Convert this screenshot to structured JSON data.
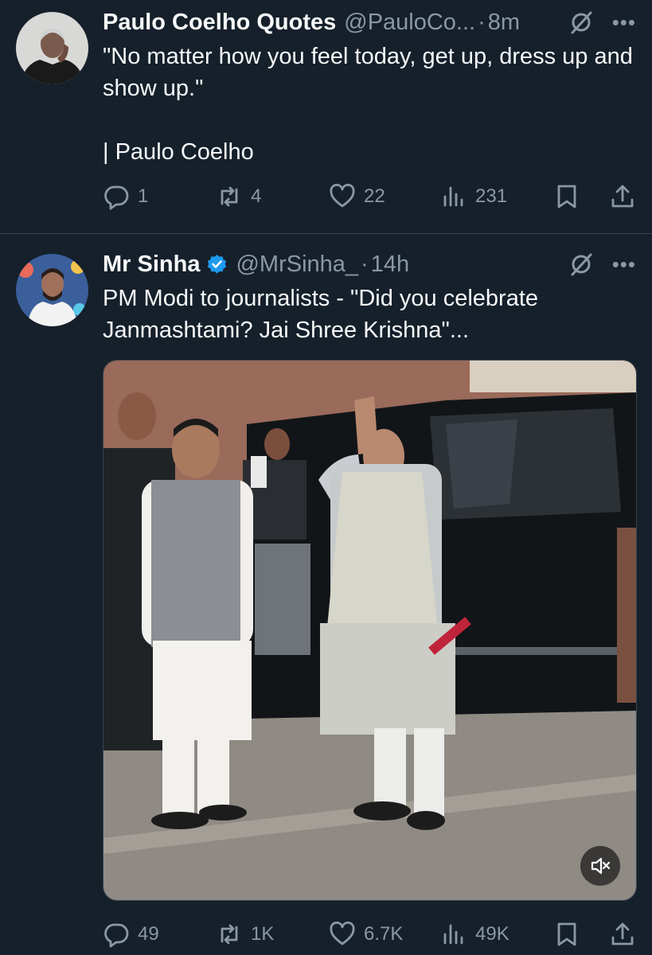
{
  "colors": {
    "background": "#15202b",
    "text": "#f7f9f9",
    "muted": "#8b98a5",
    "divider": "#38444d",
    "verified": "#1d9bf0"
  },
  "tweets": [
    {
      "display_name": "Paulo Coelho Quotes",
      "handle": "@PauloCo...",
      "separator": "·",
      "time": "8m",
      "verified": false,
      "text_lines": [
        "\"No matter how you feel today, get up, dress up and show up.\"",
        "| Paulo Coelho"
      ],
      "replies": "1",
      "retweets": "4",
      "likes": "22",
      "views": "231",
      "icons": [
        "grok-icon",
        "more-icon",
        "reply-icon",
        "retweet-icon",
        "like-icon",
        "views-icon",
        "bookmark-icon",
        "share-icon"
      ]
    },
    {
      "display_name": "Mr Sinha",
      "handle": "@MrSinha_",
      "separator": "·",
      "time": "14h",
      "verified": true,
      "text_lines": [
        "PM Modi to journalists - \"Did you celebrate Janmashtami? Jai Shree Krishna\"..."
      ],
      "media": {
        "type": "video",
        "muted": true
      },
      "replies": "49",
      "retweets": "1K",
      "likes": "6.7K",
      "views": "49K",
      "icons": [
        "grok-icon",
        "more-icon",
        "verified-badge-icon",
        "mute-icon",
        "reply-icon",
        "retweet-icon",
        "like-icon",
        "views-icon",
        "bookmark-icon",
        "share-icon"
      ]
    }
  ]
}
